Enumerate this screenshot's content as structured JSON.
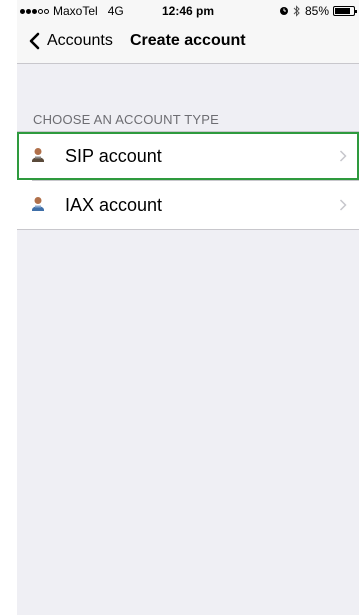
{
  "status": {
    "signal_dots": "●●●○○",
    "carrier": "MaxoTel",
    "network": "4G",
    "time": "12:46 pm",
    "battery_percent": "85%",
    "battery_level": 0.85,
    "alarm_icon": "alarm-icon",
    "bluetooth_icon": "bluetooth-icon"
  },
  "nav": {
    "back_label": "Accounts",
    "title": "Create account"
  },
  "section": {
    "header": "CHOOSE AN ACCOUNT TYPE"
  },
  "accounts": [
    {
      "label": "SIP account",
      "icon": "person-icon",
      "selected": true
    },
    {
      "label": "IAX account",
      "icon": "person-icon",
      "selected": false
    }
  ],
  "colors": {
    "selection_outline": "#2e9a3e",
    "background": "#efeff4"
  }
}
